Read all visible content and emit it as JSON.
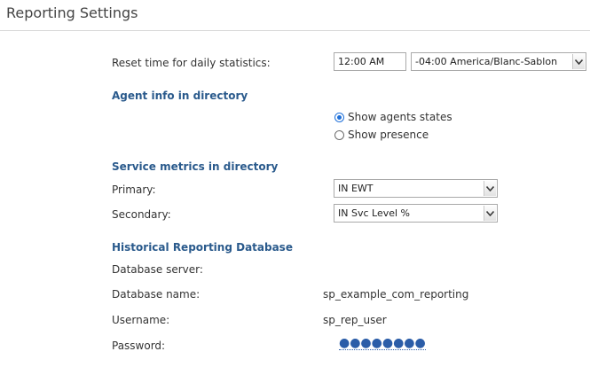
{
  "page": {
    "title": "Reporting Settings"
  },
  "reset": {
    "label": "Reset time for daily statistics:",
    "time_value": "12:00 AM",
    "timezone_value": "-04:00 America/Blanc-Sablon"
  },
  "agent_info": {
    "heading": "Agent info in directory",
    "options": [
      {
        "label": "Show agents states",
        "checked": true
      },
      {
        "label": "Show presence",
        "checked": false
      }
    ]
  },
  "service_metrics": {
    "heading": "Service metrics in directory",
    "primary_label": "Primary:",
    "primary_value": "IN EWT",
    "secondary_label": "Secondary:",
    "secondary_value": "IN Svc Level %"
  },
  "historical_db": {
    "heading": "Historical Reporting Database",
    "server_label": "Database server:",
    "server_value": "",
    "name_label": "Database name:",
    "name_value": "sp_example_com_reporting",
    "username_label": "Username:",
    "username_value": "sp_rep_user",
    "password_label": "Password:",
    "password_mask": "●●●●●●●●"
  },
  "icons": {
    "dropdown": "chevron-down-icon",
    "radio": "radio-button"
  },
  "colors": {
    "section_heading": "#2a5a8c",
    "radio_accent": "#1e6fd9",
    "password_link": "#2b5da8"
  }
}
